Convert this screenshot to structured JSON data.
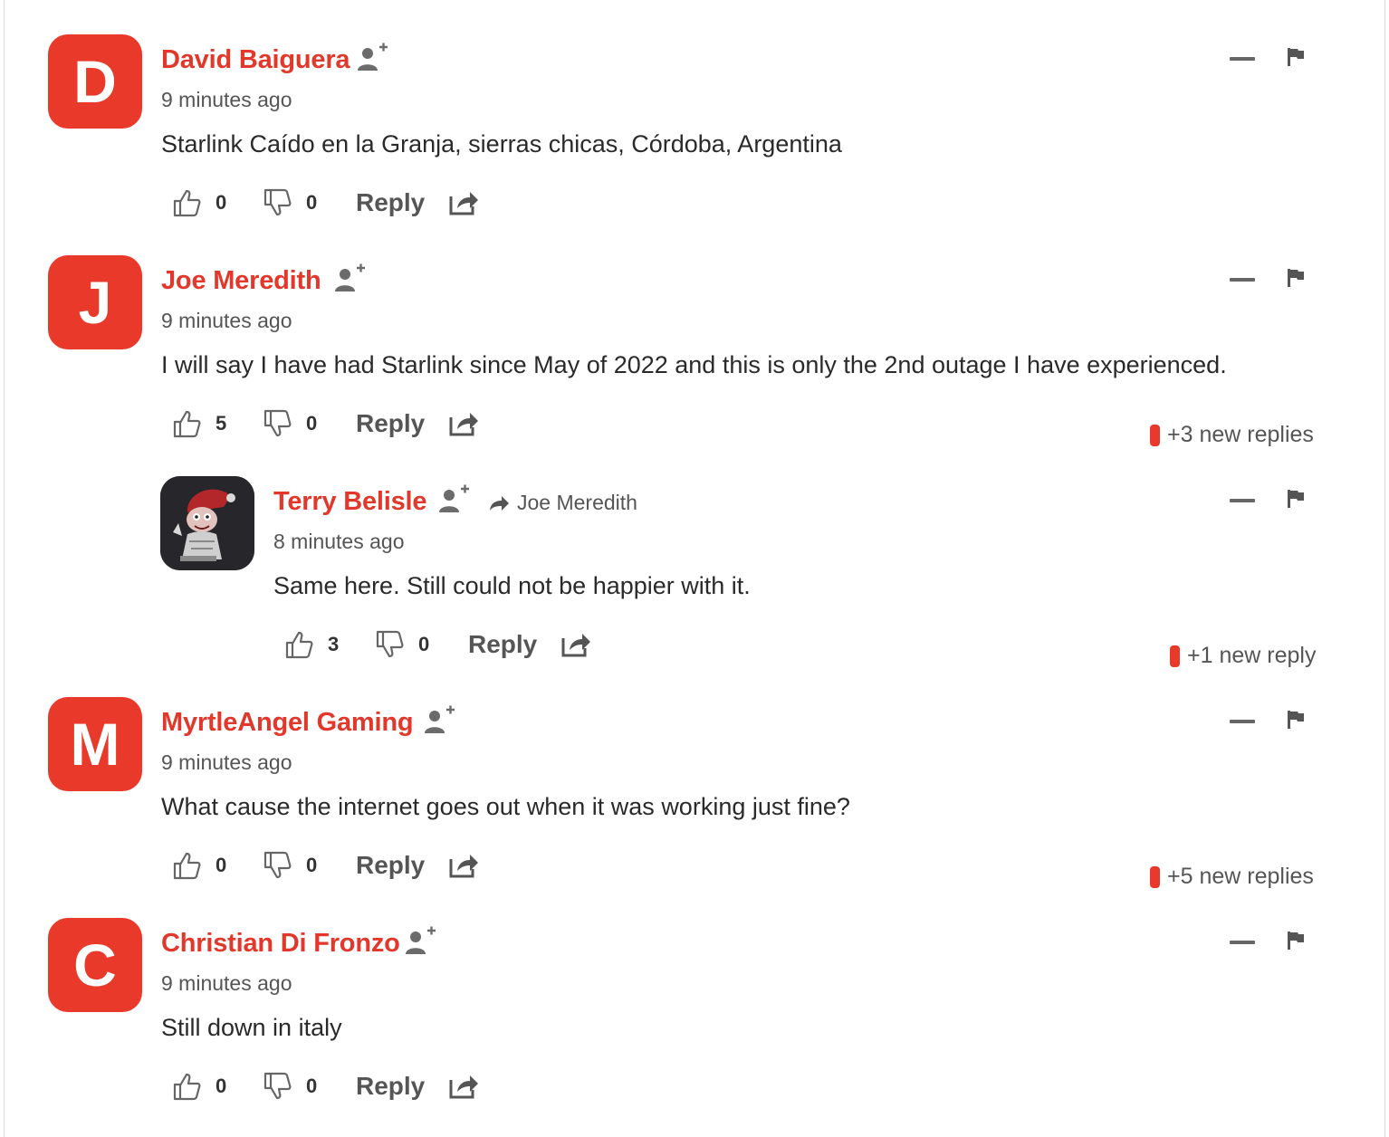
{
  "comments": [
    {
      "avatar_letter": "D",
      "author": "David Baiguera",
      "time": "9 minutes ago",
      "text": "Starlink Caído en la Granja, sierras chicas, Córdoba, Argentina",
      "likes": "0",
      "dislikes": "0",
      "reply_label": "Reply",
      "new_replies": ""
    },
    {
      "avatar_letter": "J",
      "author": "Joe Meredith",
      "time": "9 minutes ago",
      "text": "I will say I have had Starlink since May of 2022 and this is only the 2nd outage I have experienced.",
      "likes": "5",
      "dislikes": "0",
      "reply_label": "Reply",
      "new_replies": "+3 new replies"
    },
    {
      "avatar_letter": "",
      "author": "Terry Belisle",
      "reply_to": "Joe Meredith",
      "time": "8 minutes ago",
      "text": "Same here. Still could not be happier with it.",
      "likes": "3",
      "dislikes": "0",
      "reply_label": "Reply",
      "new_replies": "+1 new reply"
    },
    {
      "avatar_letter": "M",
      "author": "MyrtleAngel Gaming",
      "time": "9 minutes ago",
      "text": "What cause the internet goes out when it was working just fine?",
      "likes": "0",
      "dislikes": "0",
      "reply_label": "Reply",
      "new_replies": "+5 new replies"
    },
    {
      "avatar_letter": "C",
      "author": "Christian Di Fronzo",
      "time": "9 minutes ago",
      "text": "Still down in italy",
      "likes": "0",
      "dislikes": "0",
      "reply_label": "Reply",
      "new_replies": ""
    }
  ],
  "icons": {
    "follow": "add-user-icon",
    "like": "thumbs-up-icon",
    "dislike": "thumbs-down-icon",
    "share": "share-icon",
    "minimize": "minimize-icon",
    "flag": "flag-icon",
    "reply_arrow": "reply-arrow-icon"
  },
  "colors": {
    "accent": "#e8392a",
    "author": "#e2382b",
    "muted": "#555555"
  }
}
